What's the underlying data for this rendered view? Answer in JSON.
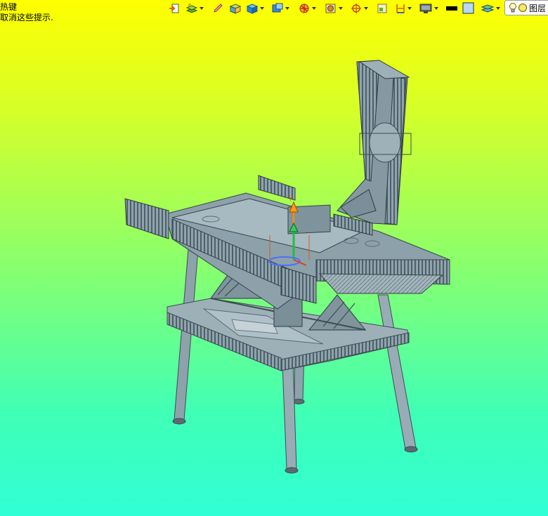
{
  "hints": {
    "line1": "热键",
    "line2": "取消这些提示."
  },
  "toolbar": {
    "layer_box_label": "图层",
    "icons": [
      "exit-sketch-icon",
      "layers-icon",
      "pencil-icon",
      "part-cube-icon",
      "view-cube-icon",
      "view-orientation-icon",
      "section-view-icon",
      "appearance-sphere-icon",
      "move-rotate-icon",
      "grid-icon",
      "dimension-icon",
      "monitor-display-icon",
      "color-swatch-black-icon",
      "color-swatch-blue-icon",
      "layer-stack-icon",
      "lightbulb-icon",
      "circle-light-icon"
    ]
  },
  "colors": {
    "background_top": "#ffff00",
    "background_bottom": "#30ffd6",
    "model_fill": "#8fa4ad",
    "model_dark": "#5b6e76",
    "axis_y": "#ff8c00",
    "axis_green": "#1fbf3a",
    "axis_blue": "#3a6cff"
  }
}
